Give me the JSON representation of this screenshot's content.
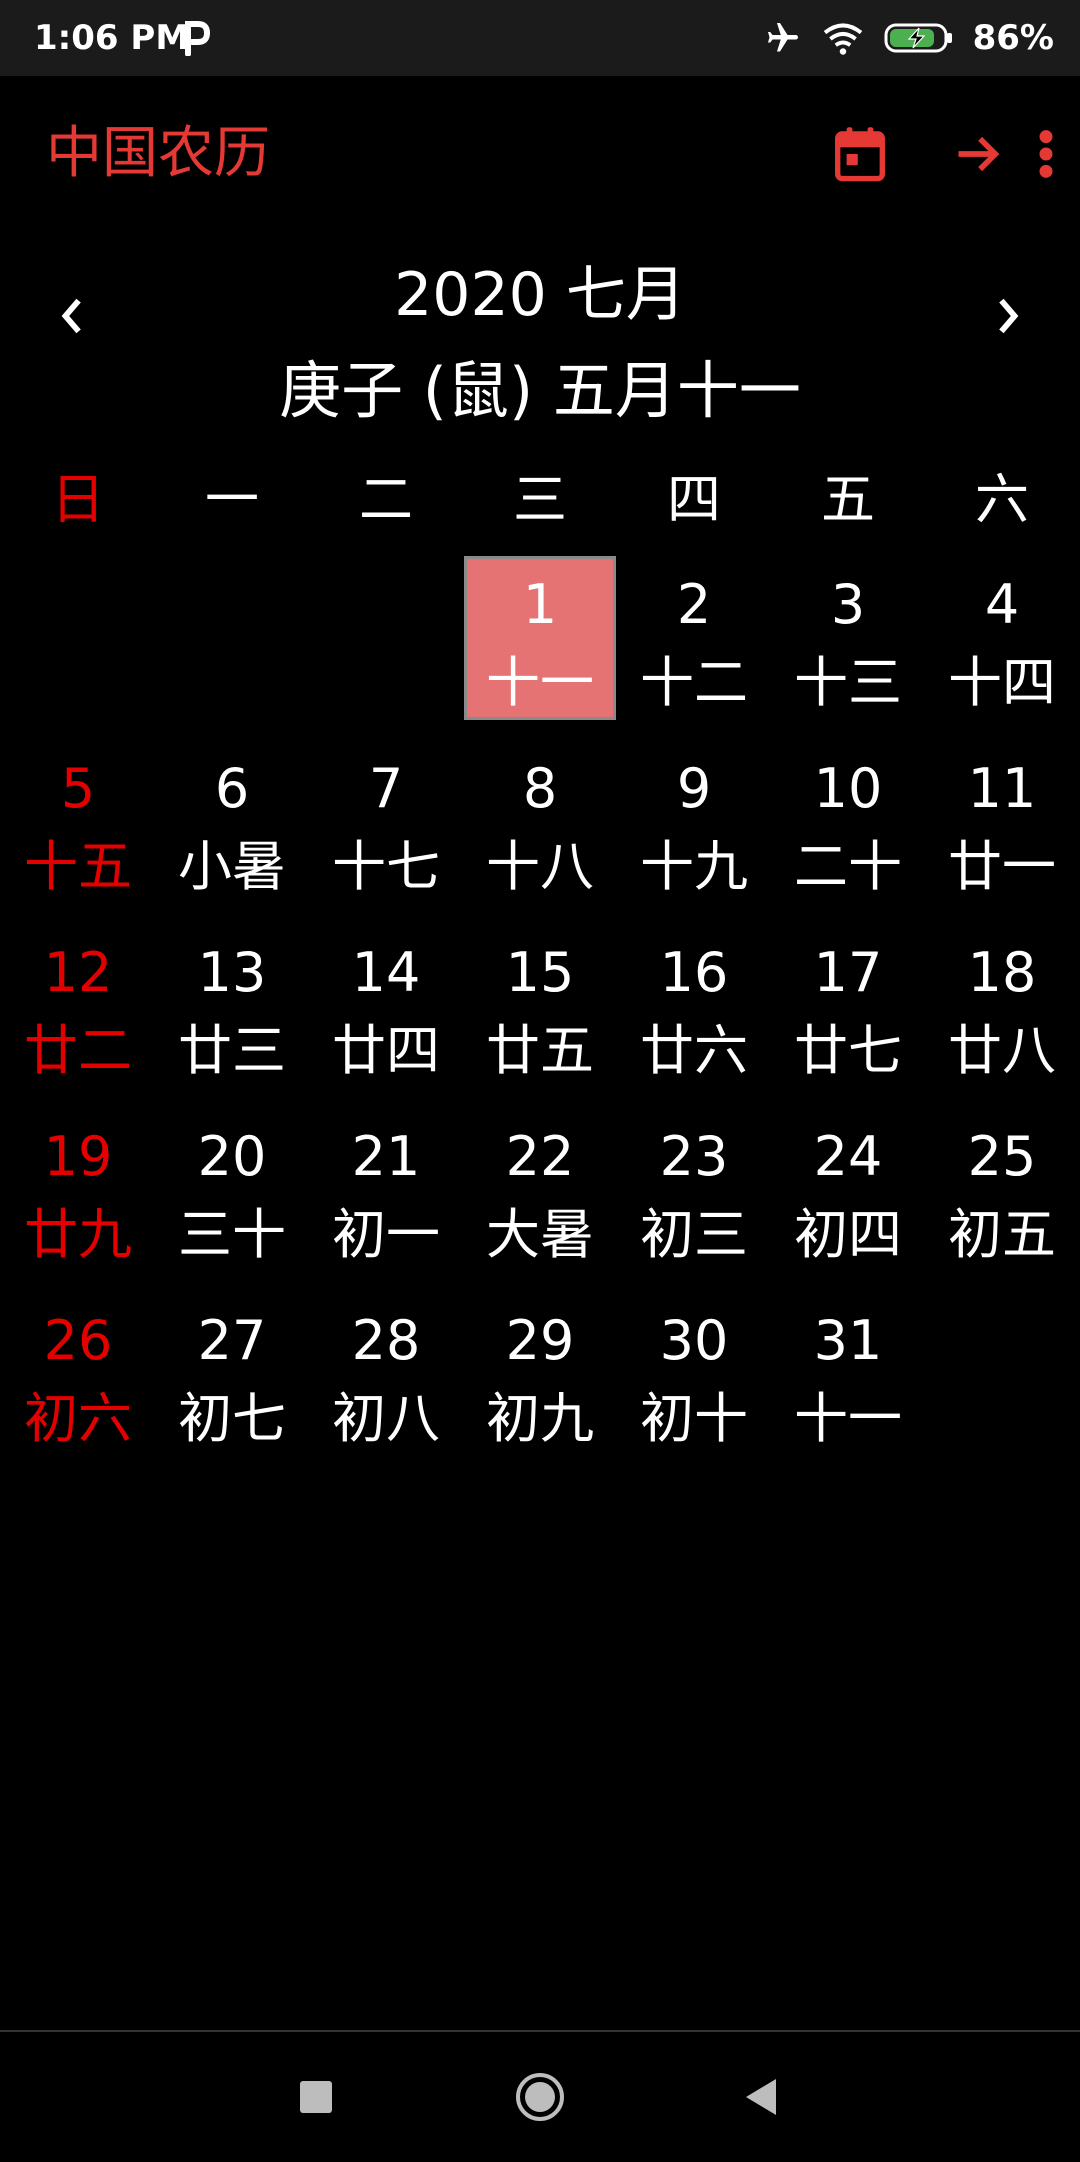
{
  "status_bar": {
    "time": "1:06 PM",
    "battery": "86%"
  },
  "app_bar": {
    "title": "中国农历",
    "actions": [
      "calendar-icon",
      "arrow-forward-icon",
      "more-vert-icon"
    ]
  },
  "colors": {
    "accent": "#e53935",
    "sunday": "#e50000",
    "today_bg": "#e57373"
  },
  "header": {
    "month": "2020 七月",
    "lunar": "庚子 (鼠) 五月十一",
    "prev_label": "‹",
    "next_label": "›"
  },
  "weekdays": [
    "日",
    "一",
    "二",
    "三",
    "四",
    "五",
    "六"
  ],
  "days": [
    {
      "d": "1",
      "l": "十一"
    },
    {
      "d": "2",
      "l": "十二"
    },
    {
      "d": "3",
      "l": "十三"
    },
    {
      "d": "4",
      "l": "十四"
    },
    {
      "d": "5",
      "l": "十五"
    },
    {
      "d": "6",
      "l": "小暑"
    },
    {
      "d": "7",
      "l": "十七"
    },
    {
      "d": "8",
      "l": "十八"
    },
    {
      "d": "9",
      "l": "十九"
    },
    {
      "d": "10",
      "l": "二十"
    },
    {
      "d": "11",
      "l": "廿一"
    },
    {
      "d": "12",
      "l": "廿二"
    },
    {
      "d": "13",
      "l": "廿三"
    },
    {
      "d": "14",
      "l": "廿四"
    },
    {
      "d": "15",
      "l": "廿五"
    },
    {
      "d": "16",
      "l": "廿六"
    },
    {
      "d": "17",
      "l": "廿七"
    },
    {
      "d": "18",
      "l": "廿八"
    },
    {
      "d": "19",
      "l": "廿九"
    },
    {
      "d": "20",
      "l": "三十"
    },
    {
      "d": "21",
      "l": "初一"
    },
    {
      "d": "22",
      "l": "大暑"
    },
    {
      "d": "23",
      "l": "初三"
    },
    {
      "d": "24",
      "l": "初四"
    },
    {
      "d": "25",
      "l": "初五"
    },
    {
      "d": "26",
      "l": "初六"
    },
    {
      "d": "27",
      "l": "初七"
    },
    {
      "d": "28",
      "l": "初八"
    },
    {
      "d": "29",
      "l": "初九"
    },
    {
      "d": "30",
      "l": "初十"
    },
    {
      "d": "31",
      "l": "十一"
    }
  ],
  "selected_day": "1",
  "nav_bar": [
    "recents-icon",
    "home-icon",
    "back-icon"
  ]
}
